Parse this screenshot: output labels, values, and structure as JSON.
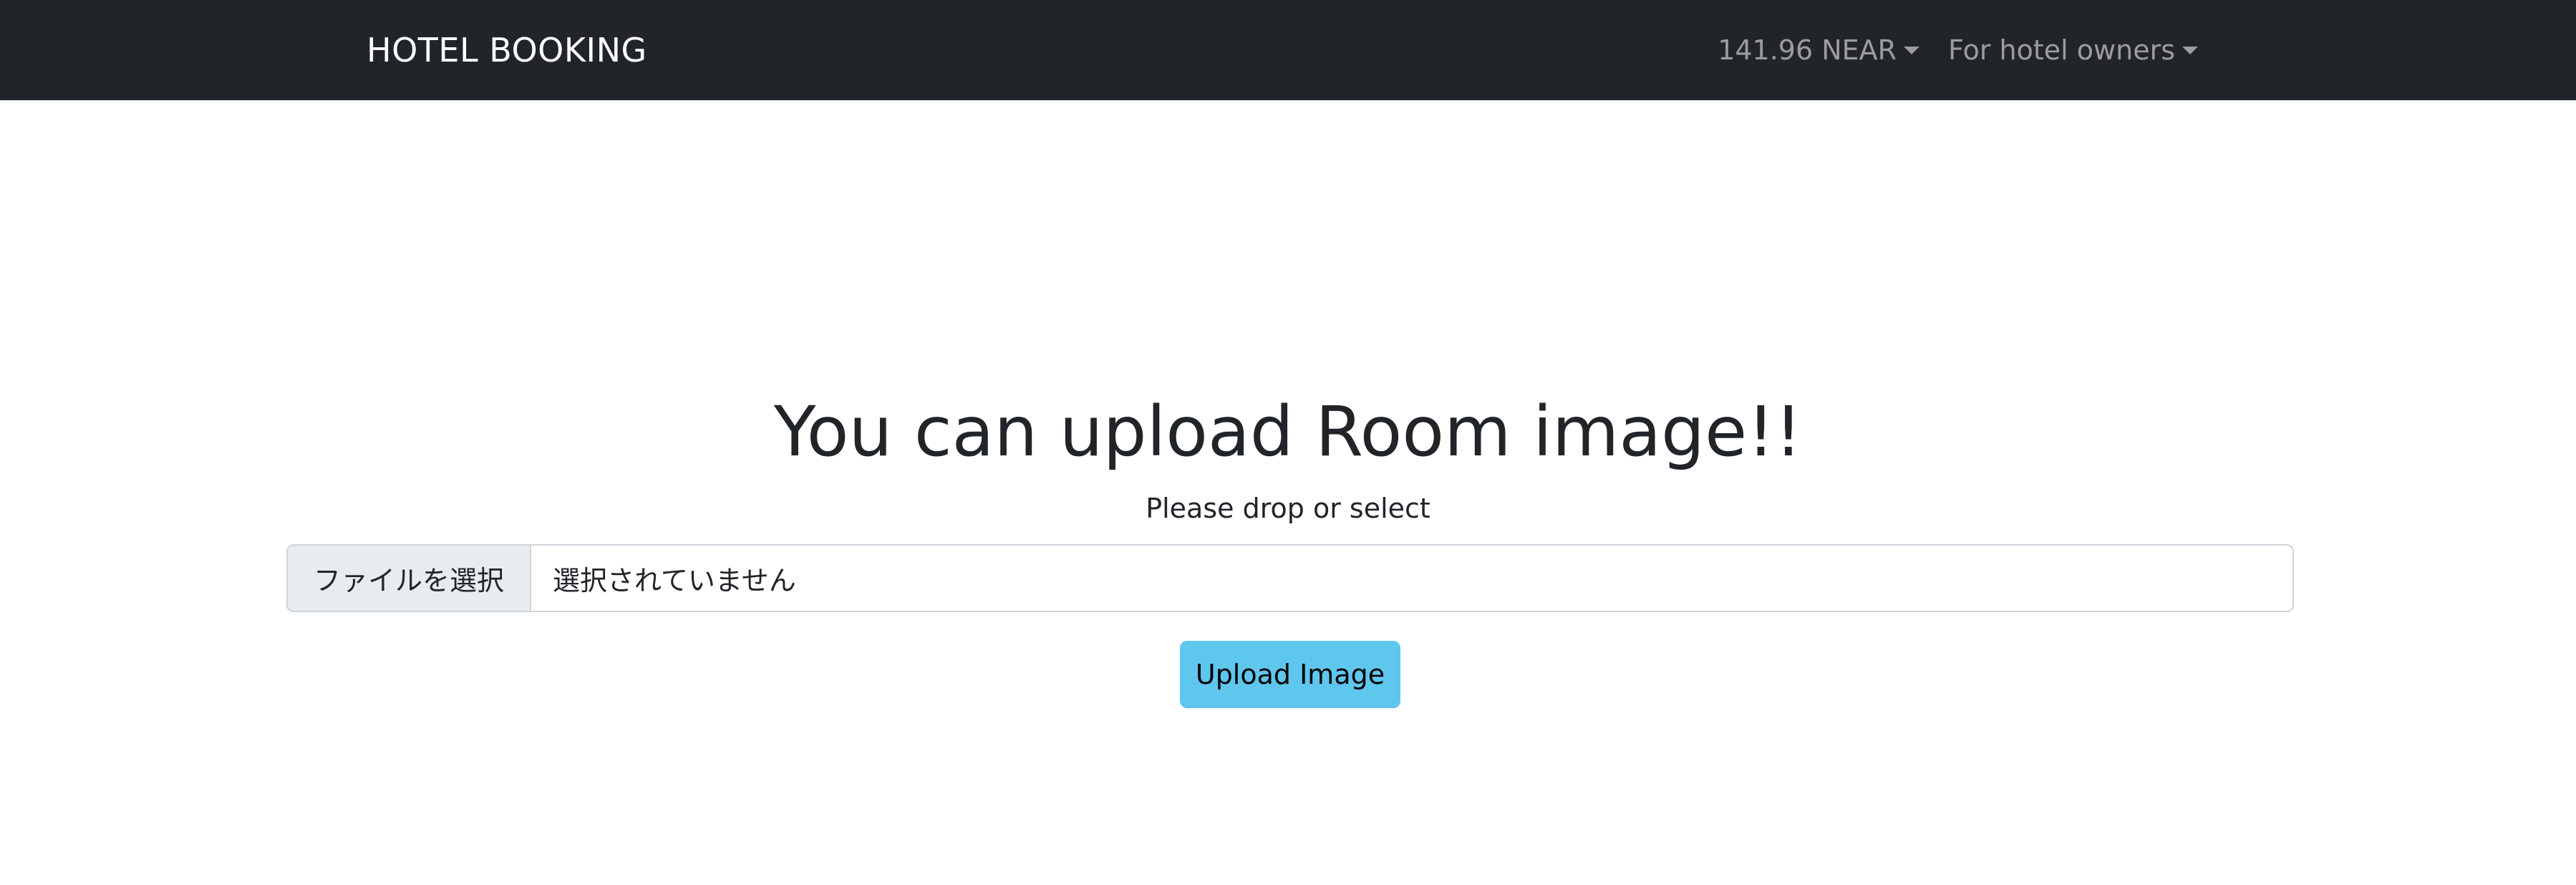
{
  "navbar": {
    "brand": "HOTEL BOOKING",
    "balance_label": "141.96 NEAR",
    "owners_label": "For hotel owners",
    "background_color": "#212529"
  },
  "main": {
    "headline": "You can upload Room image!!",
    "subtitle": "Please drop or select",
    "file_input": {
      "button_label": "ファイルを選択",
      "status_text": "選択されていません"
    },
    "upload_button_label": "Upload Image",
    "upload_button_color": "#5fc6ee"
  }
}
